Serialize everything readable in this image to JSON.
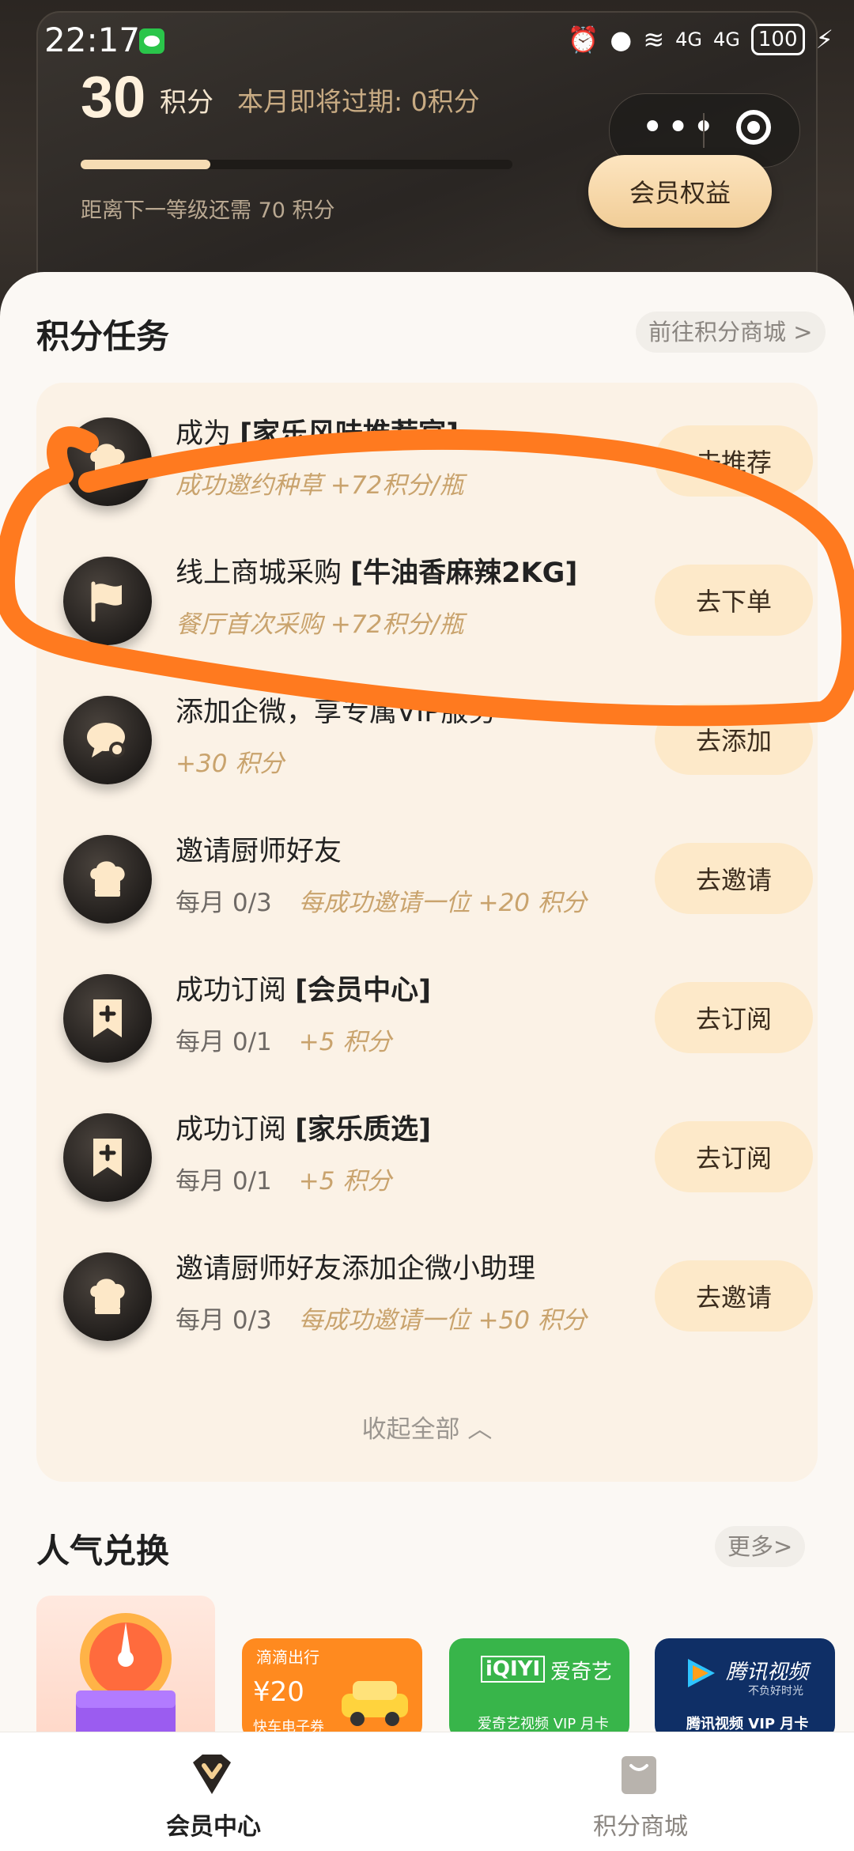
{
  "status_bar": {
    "time": "22:17",
    "network_1": "4G",
    "network_2": "4G",
    "battery": "100"
  },
  "member": {
    "points": "30",
    "points_unit": "积分",
    "expire_text": "本月即将过期: 0积分",
    "progress_fraction": 0.3,
    "level_text": "距离下一等级还需 70 积分",
    "benefit_button": "会员权益"
  },
  "tasks_section": {
    "title": "积分任务",
    "mall_link": "前往积分商城 >",
    "collapse_label": "收起全部 ︿",
    "items": [
      {
        "icon": "chef-hat-icon",
        "title_prefix": "成为 ",
        "title_bold": "[家乐风味推荐官]",
        "count": "",
        "reward": "成功邀约种草 +72积分/瓶",
        "button": "去推荐"
      },
      {
        "icon": "flag-icon",
        "title_prefix": "线上商城采购 ",
        "title_bold": "[牛油香麻辣2KG]",
        "count": "",
        "reward": "餐厅首次采购 +72积分/瓶",
        "button": "去下单"
      },
      {
        "icon": "chat-icon",
        "title_prefix": "添加企微，享专属VIP服务",
        "title_bold": "",
        "count": "",
        "reward": "+30 积分",
        "button": "去添加"
      },
      {
        "icon": "chef-hat-icon",
        "title_prefix": "邀请厨师好友",
        "title_bold": "",
        "count": "每月 0/3",
        "reward": "每成功邀请一位 +20 积分",
        "button": "去邀请"
      },
      {
        "icon": "bookmark-plus-icon",
        "title_prefix": "成功订阅 ",
        "title_bold": "[会员中心]",
        "count": "每月 0/1",
        "reward": "+5 积分",
        "button": "去订阅"
      },
      {
        "icon": "bookmark-plus-icon",
        "title_prefix": "成功订阅 ",
        "title_bold": "[家乐质选]",
        "count": "每月 0/1",
        "reward": "+5 积分",
        "button": "去订阅"
      },
      {
        "icon": "chef-hat-icon",
        "title_prefix": "邀请厨师好友添加企微小助理",
        "title_bold": "",
        "count": "每月 0/3",
        "reward": "每成功邀请一位 +50 积分",
        "button": "去邀请"
      }
    ]
  },
  "popular_section": {
    "title": "人气兑换",
    "more_link": "更多>",
    "goods": [
      {
        "name": "lucky-draw",
        "text": ""
      },
      {
        "name": "didi-coupon",
        "brand": "滴滴出行",
        "text": "¥20",
        "caption": "快车电子券"
      },
      {
        "name": "iqiyi-vip",
        "brand": "爱奇艺",
        "text": "iQIYI",
        "caption": "爱奇艺视频 VIP 月卡"
      },
      {
        "name": "tencent-video-vip",
        "brand": "腾讯视频",
        "text": "不负好时光",
        "caption": "腾讯视频 VIP 月卡"
      }
    ]
  },
  "bottom_nav": {
    "items": [
      {
        "label": "会员中心",
        "active": true
      },
      {
        "label": "积分商城",
        "active": false
      }
    ]
  },
  "colors": {
    "accent_gold": "#c9a36d",
    "button_bg": "#fde9c9",
    "annotation": "#ff7a1f"
  }
}
